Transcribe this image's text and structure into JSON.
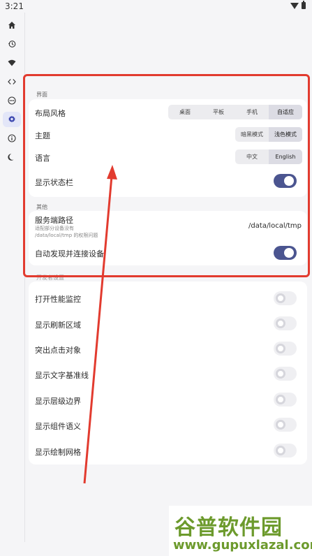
{
  "status_bar": {
    "time": "3:21"
  },
  "rail": {
    "items": [
      {
        "icon": "home-icon"
      },
      {
        "icon": "history-icon"
      },
      {
        "icon": "wifi-icon"
      },
      {
        "icon": "code-icon"
      },
      {
        "icon": "more-icon"
      },
      {
        "icon": "gear-icon",
        "active": true
      },
      {
        "icon": "info-icon"
      },
      {
        "icon": "moon-icon"
      }
    ]
  },
  "interface_section": {
    "title": "界面",
    "layout_style": {
      "label": "布局风格",
      "options": [
        "桌面",
        "平板",
        "手机",
        "自适应"
      ],
      "selected": "自适应"
    },
    "theme": {
      "label": "主题",
      "options": [
        "暗黑模式",
        "浅色模式"
      ],
      "selected": "浅色模式"
    },
    "language": {
      "label": "语言",
      "options": [
        "中文",
        "English"
      ],
      "selected": "English"
    },
    "status_bar_toggle": {
      "label": "显示状态栏",
      "on": true
    }
  },
  "other_section": {
    "title": "其他",
    "server_path": {
      "label": "服务端路径",
      "sub_line1": "适配部分设备没有",
      "sub_line2": "/data/local/tmp 的权限问题",
      "value": "/data/local/tmp"
    },
    "auto_connect": {
      "label": "自动发现并连接设备",
      "on": true
    }
  },
  "developer_section": {
    "title": "开发者设置",
    "items": [
      {
        "label": "打开性能监控",
        "on": false
      },
      {
        "label": "显示刷新区域",
        "on": false
      },
      {
        "label": "突出点击对象",
        "on": false
      },
      {
        "label": "显示文字基准线",
        "on": false
      },
      {
        "label": "显示层级边界",
        "on": false
      },
      {
        "label": "显示组件语义",
        "on": false
      },
      {
        "label": "显示绘制网格",
        "on": false
      }
    ]
  },
  "watermark": {
    "title": "谷普软件园",
    "url": "www.gupuxlazal.com"
  },
  "colors": {
    "accent": "#4b5590",
    "annotation": "#e23b2f",
    "watermark": "#6c9a2c"
  }
}
